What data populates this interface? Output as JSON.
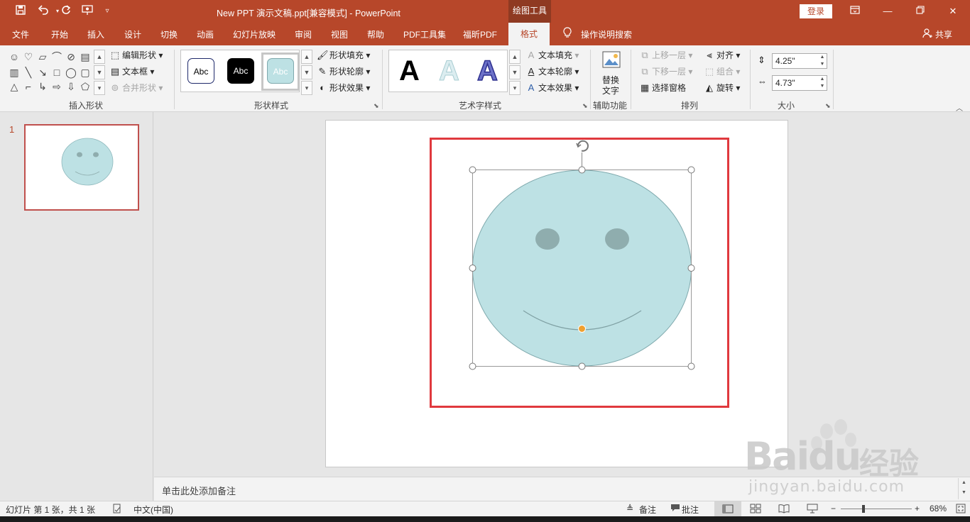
{
  "app": {
    "window_title": "New PPT 演示文稿.ppt[兼容模式]  -  PowerPoint",
    "context_tools": "绘图工具",
    "login": "登录",
    "share": "共享"
  },
  "quick_access": [
    "save-icon",
    "undo-icon",
    "redo-icon",
    "present-icon",
    "customize-icon"
  ],
  "tabs": [
    {
      "label": "文件"
    },
    {
      "label": "开始"
    },
    {
      "label": "插入"
    },
    {
      "label": "设计"
    },
    {
      "label": "切换"
    },
    {
      "label": "动画"
    },
    {
      "label": "幻灯片放映"
    },
    {
      "label": "审阅"
    },
    {
      "label": "视图"
    },
    {
      "label": "帮助"
    },
    {
      "label": "PDF工具集"
    },
    {
      "label": "福昕PDF"
    },
    {
      "label": "格式"
    }
  ],
  "tell_me": "操作说明搜索",
  "ribbon": {
    "insert_shapes": {
      "label": "插入形状",
      "edit_shape": "编辑形状",
      "text_box": "文本框",
      "merge_shapes": "合并形状"
    },
    "shape_styles": {
      "label": "形状样式",
      "sample_text": "Abc",
      "fill": "形状填充",
      "outline": "形状轮廓",
      "effects": "形状效果"
    },
    "wordart_styles": {
      "label": "艺术字样式",
      "sample_letter": "A",
      "text_fill": "文本填充",
      "text_outline": "文本轮廓",
      "text_effects": "文本效果"
    },
    "accessibility": {
      "label": "辅助功能",
      "alt_text_line1": "替换",
      "alt_text_line2": "文字"
    },
    "arrange": {
      "label": "排列",
      "bring_forward": "上移一层",
      "send_backward": "下移一层",
      "selection_pane": "选择窗格",
      "align": "对齐",
      "group": "组合",
      "rotate": "旋转"
    },
    "size": {
      "label": "大小",
      "height": "4.25\"",
      "width": "4.73\""
    }
  },
  "thumbnails": [
    {
      "number": "1"
    }
  ],
  "notes_placeholder": "单击此处添加备注",
  "status": {
    "slide_info": "幻灯片 第 1 张，共 1 张",
    "language": "中文(中国)",
    "notes": "备注",
    "comments": "批注",
    "zoom": "68%",
    "zoom_fraction": 0.68
  },
  "colors": {
    "accent": "#b7472a",
    "face_fill": "#bde1e4",
    "face_stroke": "#7fa9ad",
    "eye_fill": "#8fadae",
    "selection_frame": "#e0393e",
    "handle_adjust": "#f0a030"
  },
  "watermark": {
    "brand": "Bai",
    "brand2": "du",
    "brand_cn": "经验",
    "url": "jingyan.baidu.com"
  }
}
